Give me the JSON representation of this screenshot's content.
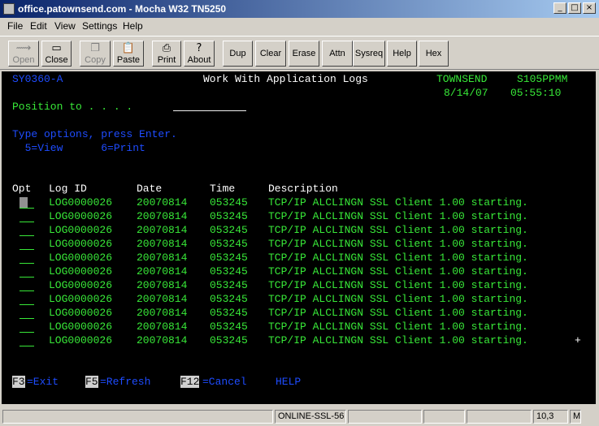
{
  "window": {
    "title": "office.patownsend.com - Mocha W32 TN5250",
    "min": "_",
    "max": "□",
    "close": "×"
  },
  "menu": {
    "file": "File",
    "edit": "Edit",
    "view": "View",
    "settings": "Settings",
    "help": "Help"
  },
  "toolbar": {
    "open": "Open",
    "close": "Close",
    "copy": "Copy",
    "paste": "Paste",
    "print": "Print",
    "about": "About",
    "dup": "Dup",
    "clear": "Clear",
    "erase": "Erase",
    "attn": "Attn",
    "sysreq": "Sysreq",
    "help": "Help",
    "hex": "Hex"
  },
  "icons": {
    "open": "⟿",
    "close": "▭",
    "copy": "❐",
    "paste": "📋",
    "print": "⎙",
    "about": "?"
  },
  "screen": {
    "program": "SY0360-A",
    "title": "Work With Application Logs",
    "system": "TOWNSEND",
    "device": "S105PPMM",
    "date": "8/14/07",
    "time": "05:55:10",
    "position_label": "Position to . . . .",
    "instructions": "Type options, press Enter.",
    "options": "  5=View      6=Print",
    "columns": {
      "opt": "Opt",
      "log_id": "Log ID",
      "date": "Date",
      "time": "Time",
      "description": "Description"
    },
    "rows": [
      {
        "log_id": "LOG0000026",
        "date": "20070814",
        "time": "053245",
        "description": "TCP/IP ALCLINGN SSL Client 1.00 starting."
      },
      {
        "log_id": "LOG0000026",
        "date": "20070814",
        "time": "053245",
        "description": "TCP/IP ALCLINGN SSL Client 1.00 starting."
      },
      {
        "log_id": "LOG0000026",
        "date": "20070814",
        "time": "053245",
        "description": "TCP/IP ALCLINGN SSL Client 1.00 starting."
      },
      {
        "log_id": "LOG0000026",
        "date": "20070814",
        "time": "053245",
        "description": "TCP/IP ALCLINGN SSL Client 1.00 starting."
      },
      {
        "log_id": "LOG0000026",
        "date": "20070814",
        "time": "053245",
        "description": "TCP/IP ALCLINGN SSL Client 1.00 starting."
      },
      {
        "log_id": "LOG0000026",
        "date": "20070814",
        "time": "053245",
        "description": "TCP/IP ALCLINGN SSL Client 1.00 starting."
      },
      {
        "log_id": "LOG0000026",
        "date": "20070814",
        "time": "053245",
        "description": "TCP/IP ALCLINGN SSL Client 1.00 starting."
      },
      {
        "log_id": "LOG0000026",
        "date": "20070814",
        "time": "053245",
        "description": "TCP/IP ALCLINGN SSL Client 1.00 starting."
      },
      {
        "log_id": "LOG0000026",
        "date": "20070814",
        "time": "053245",
        "description": "TCP/IP ALCLINGN SSL Client 1.00 starting."
      },
      {
        "log_id": "LOG0000026",
        "date": "20070814",
        "time": "053245",
        "description": "TCP/IP ALCLINGN SSL Client 1.00 starting."
      },
      {
        "log_id": "LOG0000026",
        "date": "20070814",
        "time": "053245",
        "description": "TCP/IP ALCLINGN SSL Client 1.00 starting."
      }
    ],
    "more": "+",
    "fkeys": [
      {
        "key": "F3",
        "label": "=Exit"
      },
      {
        "key": "F5",
        "label": "=Refresh"
      },
      {
        "key": "F12",
        "label": "=Cancel"
      }
    ],
    "help": "HELP"
  },
  "status": {
    "connection": "ONLINE-SSL-56",
    "cursor": "10,3",
    "mode": "M"
  }
}
